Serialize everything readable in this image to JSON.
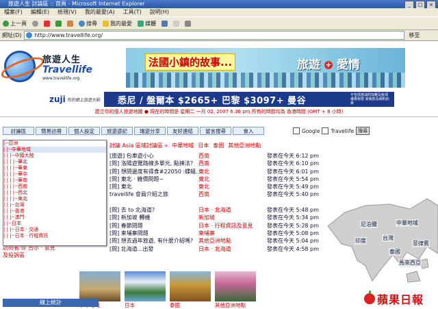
{
  "window": {
    "title": "旅遊人生 討論區 :: 首頁 - Microsoft Internet Explorer"
  },
  "menu": [
    "檔案(F)",
    "編輯(E)",
    "檢視(V)",
    "我的最愛(A)",
    "工具(T)",
    "說明(H)"
  ],
  "toolbar": {
    "back": "上一頁",
    "search": "搜尋",
    "favorites": "我的最愛",
    "media": "媒體"
  },
  "address": {
    "label": "網址(D)",
    "value": "http://www.travellife.org/",
    "go": "移至"
  },
  "logo": {
    "cn": "旅遊人生",
    "en": "Travellife",
    "url": "www.travellife.org"
  },
  "banner": {
    "headline": "法國小鎮的故事...",
    "right1": "旅遊",
    "plus": "+",
    "right2": "愛情"
  },
  "ad": {
    "brand": "zuji",
    "brand_sub": "你的網上旅遊大師",
    "text": "悉尼 / 盤爾本 $2665+   巴黎 $3097+   曼谷",
    "note": "不包括燃油附加費及稅項 優惠有限 受條款及細則約束"
  },
  "timeline": "建立你的個人旅遊地圖 ● 現在的時間是 星期二 一月 02, 2007 6:36 pm 所有的時間均為 香港時間 (GMT + 8 小時)",
  "nav": [
    "討論區",
    "簡易註冊",
    "個人設定",
    "旅遊遊記",
    "瑞遊分享",
    "友好連結",
    "留言搜尋",
    "會入"
  ],
  "search": {
    "engine": "Google",
    "site": "Travellife",
    "button": "搜尋"
  },
  "subnav": [
    "討論 Asia 區域討論區 »",
    "中華地域",
    "日本",
    "泰國",
    "其他亞洲地點"
  ],
  "dropdown": [
    "|--亞洲",
    "|  |--中華地域",
    "|  |  |--中國大陸",
    "|  |  |  |--華北",
    "|  |  |  |--華東",
    "|  |  |  |--華中",
    "|  |  |  |--華南",
    "|  |  |  |--西南",
    "|  |  |  |--西北",
    "|  |  |  |--東北",
    "|  |  |--台灣",
    "|  |  |--香港",
    "|  |  |--澳門",
    "|  |--日本",
    "|  |  |--日本 · 交通",
    "|  |  |--日本 · 行程資訊"
  ],
  "posts": [
    {
      "title": "[旅遊] 包車遊小心",
      "forum": "西南",
      "time": "發表在今天 6:12 pm"
    },
    {
      "title": "[問] 洛陽遊覽路線多單元, 點揀法?",
      "forum": "西南",
      "time": "發表在今天 6:10 pm"
    },
    {
      "title": "[問] 想問邊度有得食#22050 :蝶蜒...",
      "forum": "東北",
      "time": "發表在今天 6:01 pm"
    },
    {
      "title": "[問] 東北 · 雜價問題~",
      "forum": "東北",
      "time": "發表在今天 5:54 pm"
    },
    {
      "title": "[問] 東北",
      "forum": "東北",
      "time": "發表在今天 5:49 pm"
    },
    {
      "title": "travellife 會員介紹之旅",
      "forum": "西南",
      "time": "發表在今天 5:40 pm"
    },
    {
      "title": "",
      "forum": "",
      "time": ""
    },
    {
      "title": "[問] 去 to 北海道?",
      "forum": "日本 · 北海道",
      "time": "發表在今天 5:48 pm"
    },
    {
      "title": "[問] 新加坡 轉機",
      "forum": "新加坡",
      "time": "發表在今天 5:34 pm"
    },
    {
      "title": "[問] 春節問題",
      "forum": "日本 · 行程資訊及意見",
      "time": "發表在今天 5:28 pm"
    },
    {
      "title": "[問] 柬埔寨問題",
      "forum": "柬埔寨",
      "time": "發表在今天 5:08 pm"
    },
    {
      "title": "[問] 想去過年旅遊, 有什麼介紹嗎?",
      "forum": "其他亞洲地點",
      "time": "發表在今天 5:04 pm"
    },
    {
      "title": "[問] 北海道...出發",
      "forum": "日本 · 北海道",
      "time": "發表在今天 4:58 pm"
    }
  ],
  "map_labels": [
    "中華地域",
    "尼泊爾",
    "印度",
    "台灣",
    "菲律賓",
    "泰國",
    "馬來西亞"
  ],
  "left_links": [
    "訪問者·你 告示 · 意見",
    "及投訴區"
  ],
  "stats": "線上統計",
  "thumbs": [
    "中華地域",
    "日本",
    "泰國",
    "其他亞洲地點"
  ],
  "brand": "蘋果日報",
  "colors": {
    "accent": "#c00000",
    "nav_bg": "#e6eef8",
    "ad_bg": "#1c3a8c"
  }
}
